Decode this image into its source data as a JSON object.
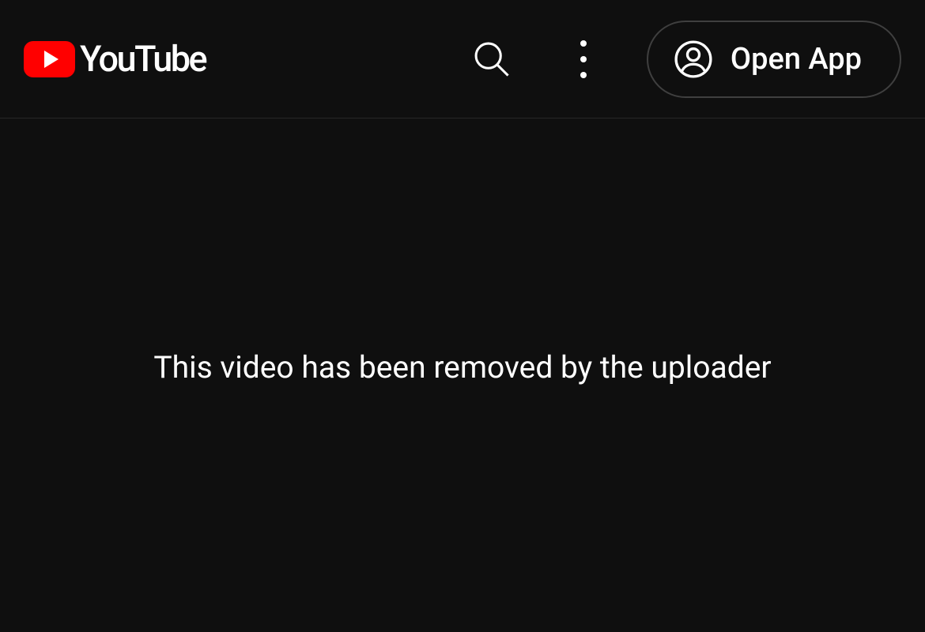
{
  "header": {
    "logo_text": "YouTube",
    "open_app_label": "Open App"
  },
  "content": {
    "error_message": "This video has been removed by the uploader"
  }
}
